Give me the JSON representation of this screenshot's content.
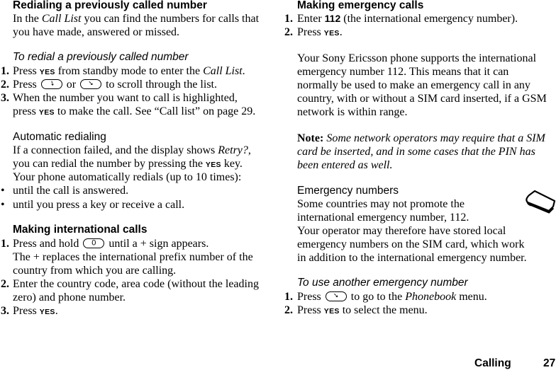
{
  "left": {
    "redial": {
      "heading": "Redialing a previously called number",
      "intro": [
        {
          "pre": "In the ",
          "em": "Call List",
          "post": " you can find the numbers for calls that"
        },
        {
          "text": "you have made, answered or missed."
        }
      ],
      "subheading": "To redial a previously called number",
      "steps": [
        {
          "num": "1.",
          "pre": "Press ",
          "key": "YES",
          "mid": " from standby mode to enter the ",
          "em": "Call List",
          "post": "."
        },
        {
          "num": "2.",
          "pre": "Press ",
          "or": " or ",
          "post": " to scroll through the list."
        },
        {
          "num": "3.",
          "line1": "When the number you want to call is highlighted,",
          "pre": "press ",
          "key": "YES",
          "post": " to make the call. See “Call list” on page 29."
        }
      ]
    },
    "auto": {
      "heading": "Automatic redialing",
      "line1_pre": "If a connection failed, and the display shows ",
      "line1_em": "Retry?",
      "line1_post": ",",
      "line2_pre": "you can redial the number by pressing the ",
      "line2_key": "YES",
      "line2_post": " key.",
      "line3": "Your phone automatically redials (up to 10 times):",
      "bullets": [
        "until the call is answered.",
        "until you press a key or receive a call."
      ],
      "bullet_char": "•"
    },
    "intl": {
      "heading": "Making international calls",
      "steps": [
        {
          "num": "1.",
          "pre": "Press and hold ",
          "key_label": "0",
          "post": " until a + sign appears.",
          "line2": "The + replaces the international prefix number of the",
          "line3": "country from which you are calling."
        },
        {
          "num": "2.",
          "line1": "Enter the country code, area code (without the leading",
          "line2": "zero) and phone number."
        },
        {
          "num": "3.",
          "pre": "Press ",
          "key": "YES",
          "post": "."
        }
      ]
    }
  },
  "right": {
    "emergency": {
      "heading": "Making emergency calls",
      "steps": [
        {
          "num": "1.",
          "pre": "Enter ",
          "bold": "112",
          "post": " (the international emergency number)."
        },
        {
          "num": "2.",
          "pre": "Press ",
          "key": "YES",
          "post": "."
        }
      ],
      "para": [
        "Your Sony Ericsson phone supports the international",
        "emergency number 112. This means that it can",
        "normally be used to make an emergency call in any",
        "country, with or without a SIM card inserted, if a GSM",
        "network is within range."
      ],
      "note_label": "Note:",
      "note_lines": [
        " Some network operators may require that a SIM",
        "card be inserted, and in some cases that the PIN has",
        "been entered as well."
      ]
    },
    "numbers": {
      "heading": "Emergency numbers",
      "lines": [
        "Some countries may not promote the",
        "international emergency number, 112.",
        "Your operator may therefore have stored local",
        "emergency numbers on the SIM card, which work",
        "in addition to the international emergency number."
      ],
      "icon": "phone-handset-icon"
    },
    "another": {
      "subheading": "To use another emergency number",
      "steps": [
        {
          "num": "1.",
          "pre": "Press ",
          "post": " to go to the ",
          "em": "Phonebook",
          "post2": " menu."
        },
        {
          "num": "2.",
          "pre": "Press ",
          "key": "YES",
          "post": " to select the menu."
        }
      ]
    }
  },
  "footer": {
    "section": "Calling",
    "page": "27"
  },
  "icons": {
    "nav_down": "navigation-key-down-icon",
    "nav_up": "navigation-key-up-icon",
    "zero_key": "zero-key-icon"
  }
}
